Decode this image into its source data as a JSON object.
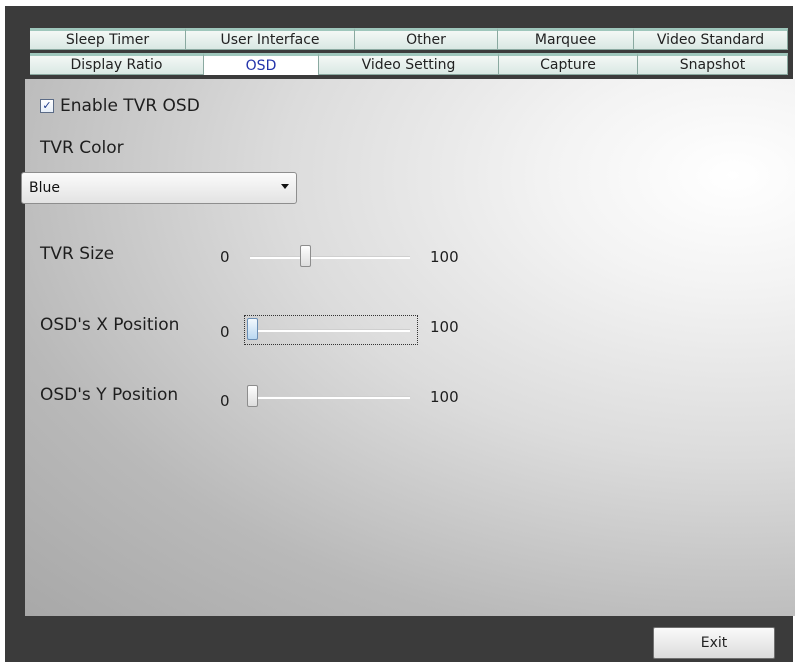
{
  "tabs": {
    "row1": [
      "Sleep Timer",
      "User Interface",
      "Other",
      "Marquee",
      "Video Standard"
    ],
    "row2": [
      "Display Ratio",
      "OSD",
      "Video Setting",
      "Capture",
      "Snapshot"
    ],
    "active": "OSD"
  },
  "osd": {
    "enable_label": "Enable TVR OSD",
    "enable_checked": true,
    "color_label": "TVR Color",
    "color_value": "Blue",
    "size_label": "TVR Size",
    "size_min": "0",
    "size_max": "100",
    "size_value": 33,
    "x_label": "OSD's X Position",
    "x_min": "0",
    "x_max": "100",
    "x_value": 0,
    "y_label": "OSD's Y Position",
    "y_min": "0",
    "y_max": "100",
    "y_value": 0
  },
  "buttons": {
    "exit_label": "Exit"
  }
}
